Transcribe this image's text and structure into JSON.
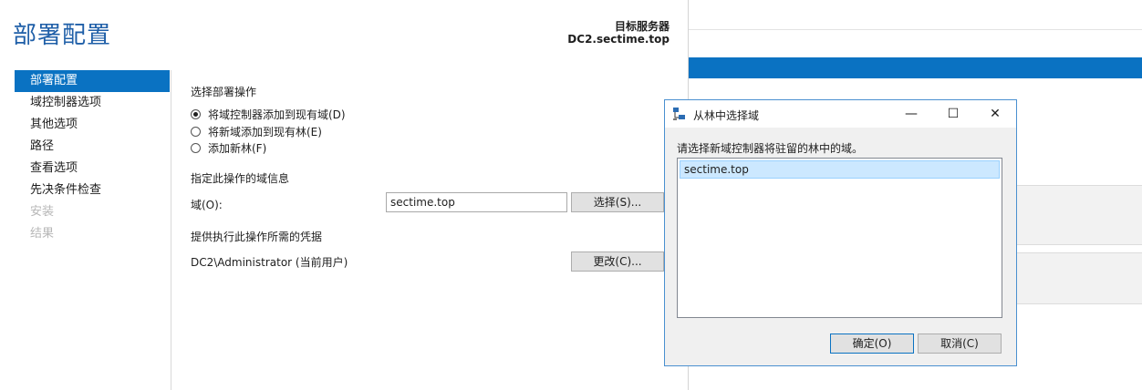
{
  "wizard": {
    "title": "部署配置",
    "target_server_label": "目标服务器",
    "target_server_value": "DC2.sectime.top",
    "nav_items": [
      {
        "label": "部署配置",
        "state": "active"
      },
      {
        "label": "域控制器选项",
        "state": "normal"
      },
      {
        "label": "其他选项",
        "state": "normal"
      },
      {
        "label": "路径",
        "state": "normal"
      },
      {
        "label": "查看选项",
        "state": "normal"
      },
      {
        "label": "先决条件检查",
        "state": "normal"
      },
      {
        "label": "安装",
        "state": "disabled"
      },
      {
        "label": "结果",
        "state": "disabled"
      }
    ],
    "select_operation_heading": "选择部署操作",
    "operations": [
      {
        "label": "将域控制器添加到现有域(D)",
        "checked": true
      },
      {
        "label": "将新域添加到现有林(E)",
        "checked": false
      },
      {
        "label": "添加新林(F)",
        "checked": false
      }
    ],
    "domain_info_heading": "指定此操作的域信息",
    "domain_label": "域(O):",
    "domain_value": "sectime.top",
    "select_button": "选择(S)...",
    "credentials_heading": "提供执行此操作所需的凭据",
    "credentials_value": "DC2\\Administrator (当前用户)",
    "change_button": "更改(C)..."
  },
  "dialog": {
    "title": "从林中选择域",
    "minimize_glyph": "—",
    "maximize_glyph": "☐",
    "close_glyph": "✕",
    "prompt": "请选择新域控制器将驻留的林中的域。",
    "domains": [
      "sectime.top"
    ],
    "ok_button": "确定(O)",
    "cancel_button": "取消(C)"
  },
  "colors": {
    "accent": "#0a72c2",
    "title_blue": "#1f5fa8",
    "selection": "#cce8ff"
  }
}
